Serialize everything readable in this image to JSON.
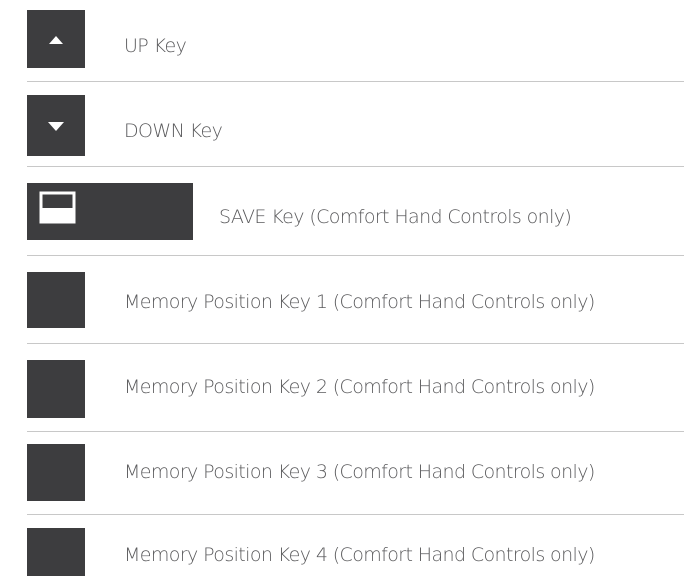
{
  "keys": [
    {
      "name": "up-key",
      "label": "UP Key",
      "icon": "triangle-up-icon"
    },
    {
      "name": "down-key",
      "label": "DOWN Key",
      "icon": "triangle-down-icon"
    },
    {
      "name": "save-key",
      "label": "SAVE Key (Comfort Hand Controls only)",
      "icon": "save-icon"
    },
    {
      "name": "memory-key-1",
      "label": "Memory Position Key 1 (Comfort Hand Controls only)",
      "icon": ""
    },
    {
      "name": "memory-key-2",
      "label": "Memory Position Key 2 (Comfort Hand Controls only)",
      "icon": ""
    },
    {
      "name": "memory-key-3",
      "label": "Memory Position Key 3 (Comfort Hand Controls only)",
      "icon": ""
    },
    {
      "name": "memory-key-4",
      "label": "Memory Position Key 4 (Comfort Hand Controls only)",
      "icon": ""
    }
  ],
  "colors": {
    "key_fill": "#3d3d3f",
    "label_text": "#5a5a5c",
    "divider": "#c8c8c8",
    "icon": "#ffffff"
  }
}
